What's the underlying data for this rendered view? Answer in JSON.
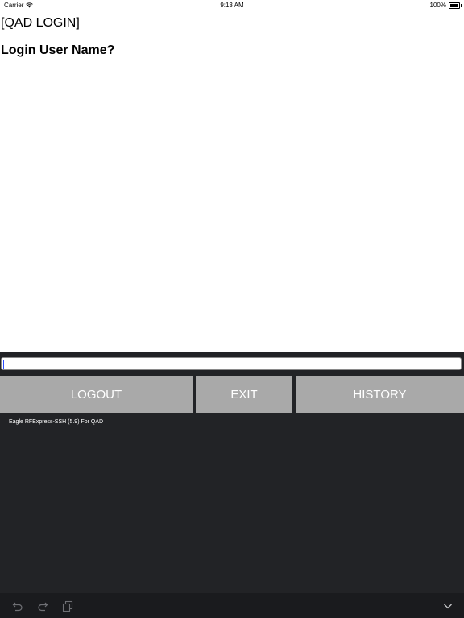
{
  "status_bar": {
    "carrier": "Carrier",
    "time": "9:13 AM",
    "battery": "100%"
  },
  "terminal": {
    "title": "[QAD LOGIN]",
    "prompt": "Login User Name?"
  },
  "input": {
    "value": "",
    "placeholder": ""
  },
  "buttons": {
    "logout": "LOGOUT",
    "exit": "EXIT",
    "history": "HISTORY"
  },
  "footer": {
    "app_name": "Eagle RFExpress-SSH (5.9) For QAD"
  },
  "toolbar": {
    "icons": [
      "undo-icon",
      "redo-icon",
      "paste-icon",
      "keyboard-dismiss-icon"
    ]
  },
  "colors": {
    "panel_background": "#222326",
    "button_background": "#a9a9a9",
    "button_text": "#ffffff",
    "cursor": "#2a4cff"
  }
}
